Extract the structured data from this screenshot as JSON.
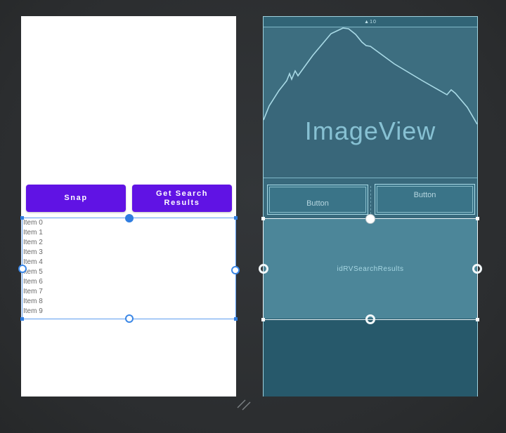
{
  "window": {
    "background_color": "#2b2d2f",
    "selection_blue": "#2f7de0",
    "selection_white": "#f2f8fa"
  },
  "design_view": {
    "buttons": [
      {
        "label": "Snap"
      },
      {
        "label": "Get Search Results"
      }
    ],
    "button_color": "#6013e4",
    "list_items": [
      "Item 0",
      "Item 1",
      "Item 2",
      "Item 3",
      "Item 4",
      "Item 5",
      "Item 6",
      "Item 7",
      "Item 8",
      "Item 9"
    ]
  },
  "blueprint_view": {
    "status_indicator": "▲10",
    "imageview_label": "ImageView",
    "button_labels": [
      "Button",
      "Button"
    ],
    "recycler_id": "idRVSearchResults",
    "background": "#3d6e80",
    "recycler_bg": "#4c8699",
    "bottom_bg": "#27596b",
    "outline": "#a9dae6"
  }
}
